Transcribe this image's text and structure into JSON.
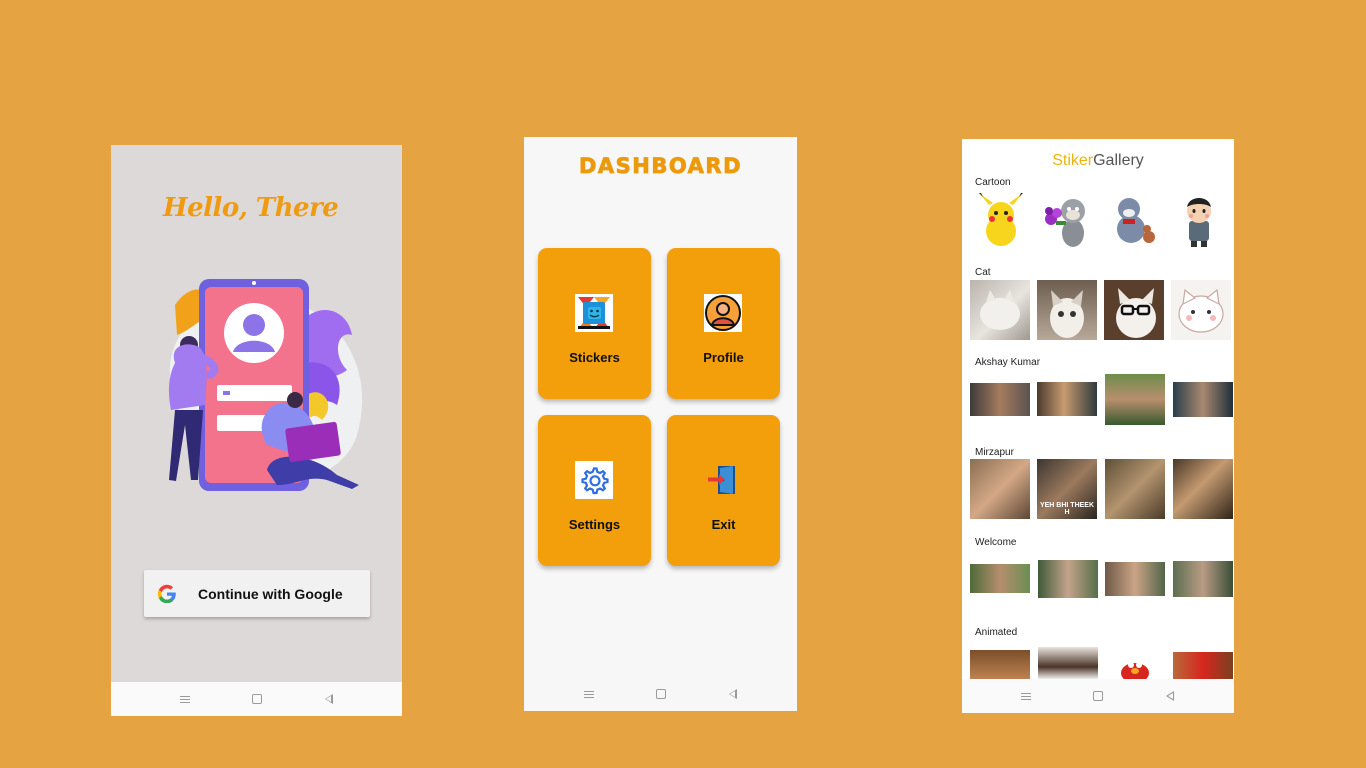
{
  "login": {
    "greeting": "Hello, There",
    "google_button": "Continue with Google"
  },
  "dashboard": {
    "title": "DASHBOARD",
    "tiles": [
      {
        "label": "Stickers",
        "icon": "sticker-icon"
      },
      {
        "label": "Profile",
        "icon": "profile-icon"
      },
      {
        "label": "Settings",
        "icon": "settings-gear-icon"
      },
      {
        "label": "Exit",
        "icon": "exit-door-icon"
      }
    ]
  },
  "gallery": {
    "title_part1": "Stiker",
    "title_part2": "Gallery",
    "categories": [
      {
        "label": "Cartoon"
      },
      {
        "label": "Cat"
      },
      {
        "label": "Akshay Kumar"
      },
      {
        "label": "Mirzapur"
      },
      {
        "label": "Welcome"
      },
      {
        "label": "Animated"
      }
    ],
    "captions": [
      "YEH BHI THEEK H"
    ]
  },
  "colors": {
    "background": "#E5A441",
    "accent": "#F39E0B",
    "gallery_title_accent": "#E9B40E"
  }
}
